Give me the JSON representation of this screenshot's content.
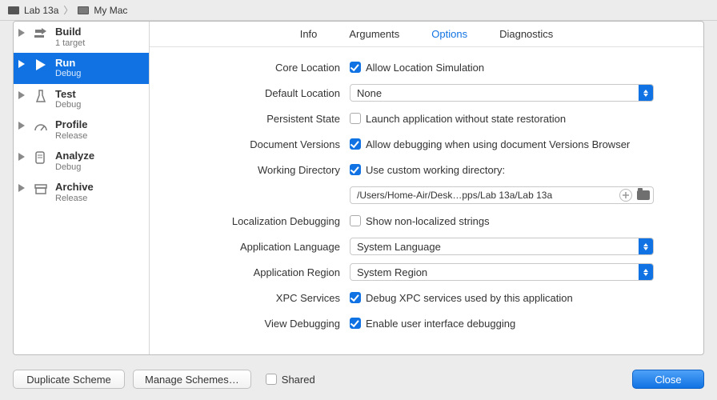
{
  "breadcrumb": {
    "project": "Lab 13a",
    "target": "My Mac"
  },
  "sidebar": [
    {
      "title": "Build",
      "sub": "1 target"
    },
    {
      "title": "Run",
      "sub": "Debug"
    },
    {
      "title": "Test",
      "sub": "Debug"
    },
    {
      "title": "Profile",
      "sub": "Release"
    },
    {
      "title": "Analyze",
      "sub": "Debug"
    },
    {
      "title": "Archive",
      "sub": "Release"
    }
  ],
  "tabs": {
    "info": "Info",
    "arguments": "Arguments",
    "options": "Options",
    "diagnostics": "Diagnostics"
  },
  "form": {
    "coreLocation": {
      "label": "Core Location",
      "text": "Allow Location Simulation",
      "checked": true
    },
    "defaultLocation": {
      "label": "Default Location",
      "value": "None"
    },
    "persistentState": {
      "label": "Persistent State",
      "text": "Launch application without state restoration",
      "checked": false
    },
    "documentVersions": {
      "label": "Document Versions",
      "text": "Allow debugging when using document Versions Browser",
      "checked": true
    },
    "workingDirectory": {
      "label": "Working Directory",
      "text": "Use custom working directory:",
      "checked": true,
      "path": "/Users/Home-Air/Desk…pps/Lab 13a/Lab 13a"
    },
    "localizationDebugging": {
      "label": "Localization Debugging",
      "text": "Show non-localized strings",
      "checked": false
    },
    "applicationLanguage": {
      "label": "Application Language",
      "value": "System Language"
    },
    "applicationRegion": {
      "label": "Application Region",
      "value": "System Region"
    },
    "xpcServices": {
      "label": "XPC Services",
      "text": "Debug XPC services used by this application",
      "checked": true
    },
    "viewDebugging": {
      "label": "View Debugging",
      "text": "Enable user interface debugging",
      "checked": true
    }
  },
  "footer": {
    "duplicate": "Duplicate Scheme",
    "manage": "Manage Schemes…",
    "shared": "Shared",
    "close": "Close"
  }
}
